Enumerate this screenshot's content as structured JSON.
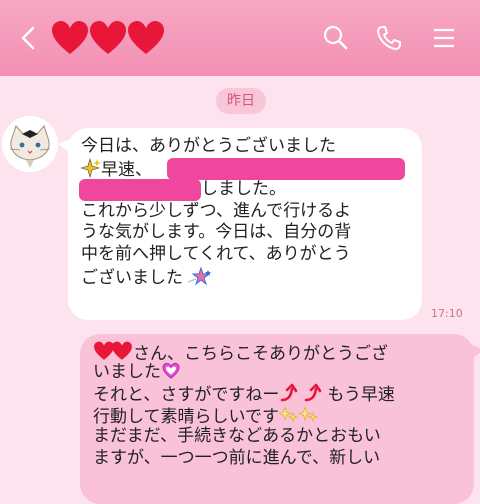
{
  "header": {
    "back_icon": "chevron-left-icon",
    "title_icons": [
      "heart-icon",
      "heart-icon",
      "heart-icon"
    ],
    "actions": [
      "search-icon",
      "phone-icon",
      "menu-icon"
    ],
    "colors": {
      "bar": "#f390b3",
      "heart": "#e8173a"
    }
  },
  "date_label": "昨日",
  "incoming": {
    "lines": [
      "今日は、ありがとうございました",
      "早速、",
      "しました。",
      "これから少しずつ、進んで行けるよ",
      "うな気がします。今日は、自分の背",
      "中を前へ押してくれて、ありがとう",
      "ございました"
    ],
    "time": "17:10"
  },
  "outgoing": {
    "lines": [
      "さん、こちらこそありがとうござ",
      "いました",
      "それと、さすがですねー",
      "もう早速",
      "行動して素晴らしいです",
      "まだまだ、手続きなどあるかとおもい",
      "ますが、一つ一つ前に進んで、新しい"
    ]
  }
}
